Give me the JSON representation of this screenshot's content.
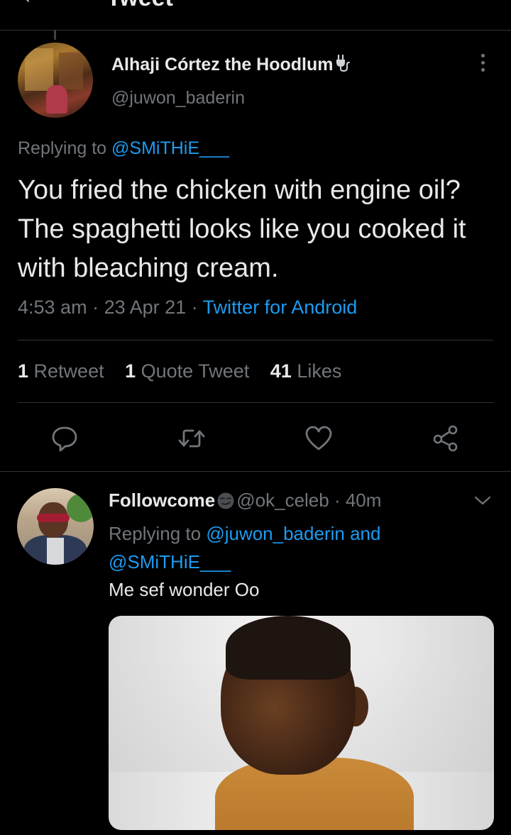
{
  "header": {
    "back_glyph": "←",
    "title": "Tweet"
  },
  "tweet": {
    "display_name": "Alhaji Córtez the Hoodlum",
    "handle": "@juwon_baderin",
    "replying_prefix": "Replying to ",
    "replying_to": "@SMiTHiE___",
    "text": "You fried the chicken with engine oil? The spaghetti looks like you cooked it with bleaching cream.",
    "time": "4:53 am",
    "date": "23 Apr 21",
    "separator": " · ",
    "source": "Twitter for Android",
    "stats": {
      "retweets_count": "1",
      "retweets_label": " Retweet",
      "quotes_count": "1",
      "quotes_label": " Quote Tweet",
      "likes_count": "41",
      "likes_label": " Likes"
    }
  },
  "reply": {
    "display_name": "Followcome",
    "emoji": "smirking-face-emoji",
    "handle": "@ok_celeb",
    "separator": " · ",
    "age": "40m",
    "replying_prefix": "Replying to ",
    "replying_to_1": "@juwon_baderin",
    "replying_join": " and ",
    "replying_to_2": "@SMiTHiE___",
    "text": "Me sef wonder Oo"
  },
  "icons": {
    "name_badge": "plug-icon",
    "more": "more-vertical-icon",
    "reply": "reply-icon",
    "retweet": "retweet-icon",
    "like": "heart-icon",
    "share": "share-icon",
    "chevron": "chevron-down-icon"
  },
  "colors": {
    "background": "#000000",
    "text_primary": "#e7e9ea",
    "text_secondary": "#71767b",
    "accent": "#1d9bf0",
    "divider": "#2f3336"
  }
}
